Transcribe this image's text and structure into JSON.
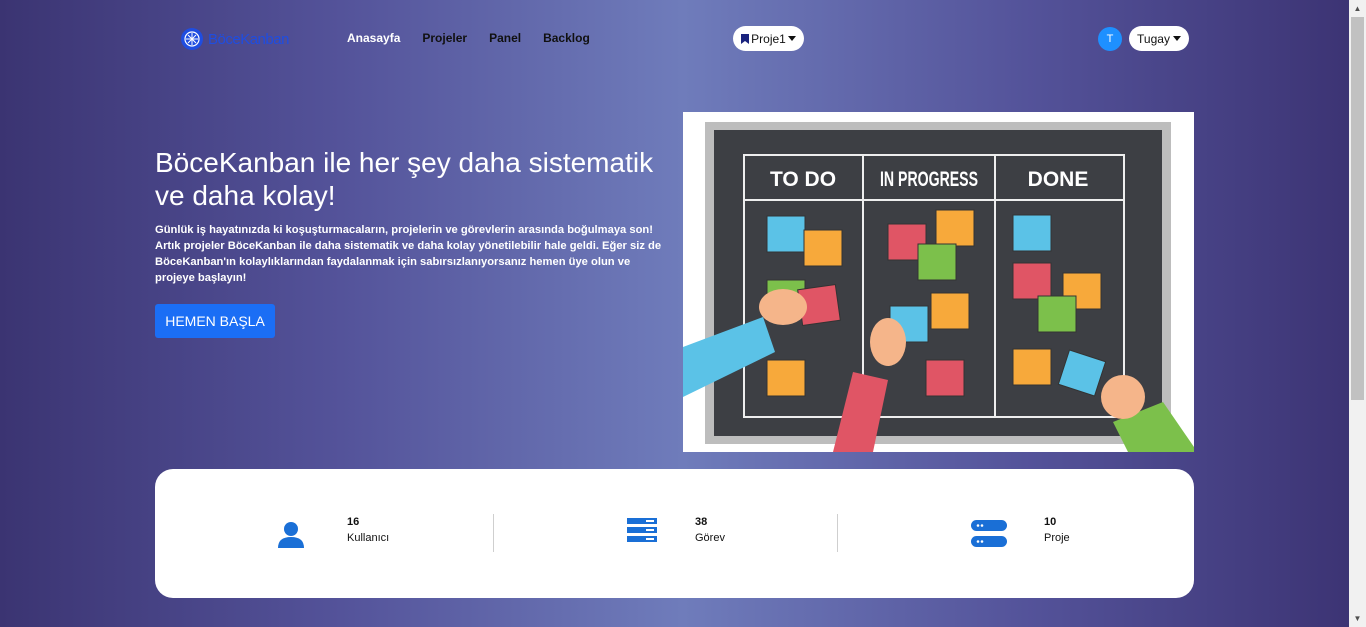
{
  "brand": {
    "name": "BöceKanban",
    "color": "#1f4de0"
  },
  "nav": {
    "items": [
      {
        "label": "Anasayfa",
        "active": true
      },
      {
        "label": "Projeler",
        "active": false
      },
      {
        "label": "Panel",
        "active": false
      },
      {
        "label": "Backlog",
        "active": false
      }
    ]
  },
  "project_selector": {
    "label": "Proje1",
    "icon": "bookmark-icon"
  },
  "user": {
    "avatar_initial": "T",
    "name": "Tugay"
  },
  "hero": {
    "title": "BöceKanban ile her şey daha sistematik ve daha kolay!",
    "text": "Günlük iş hayatınızda ki koşuşturmacaların, projelerin ve görevlerin arasında boğulmaya son! Artık projeler BöceKanban ile daha sistematik ve daha kolay yönetilebilir hale geldi. Eğer siz de BöceKanban'ın kolaylıklarından faydalanmak için sabırsızlanıyorsanız hemen üye olun ve projeye başlayın!",
    "button": "HEMEN BAŞLA",
    "image": {
      "columns": [
        "TO DO",
        "IN PROGRESS",
        "DONE"
      ]
    }
  },
  "stats": [
    {
      "value": "16",
      "label": "Kullanıcı",
      "icon": "user-icon"
    },
    {
      "value": "38",
      "label": "Görev",
      "icon": "tasks-icon"
    },
    {
      "value": "10",
      "label": "Proje",
      "icon": "server-icon"
    }
  ],
  "colors": {
    "accent": "#1b6ef5",
    "stat_icon": "#1a6fd6"
  }
}
